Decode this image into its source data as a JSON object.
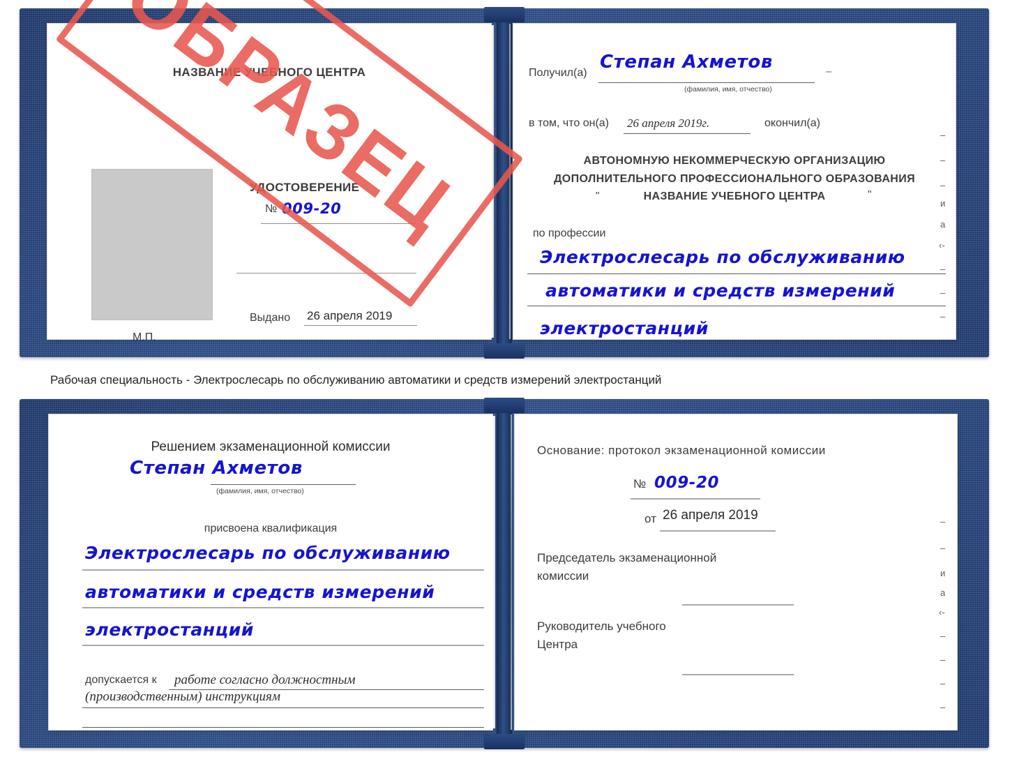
{
  "stamp": {
    "text": "ОБРАЗЕЦ",
    "color": "#e8584f"
  },
  "colors": {
    "cover_blue": "#24427a",
    "page_white": "#ffffff",
    "handwriting_blue": "#1414d2",
    "photo_placeholder_gray": "#c9c9c9",
    "rule_gray": "#8f8f8f"
  },
  "caption": {
    "text": "Рабочая специальность - Электрослесарь по обслуживанию автоматики и средств измерений электростанций"
  },
  "certificate_top": {
    "left_page": {
      "center_name": "НАЗВАНИЕ УЧЕБНОГО ЦЕНТРА",
      "doc_title": "УДОСТОВЕРЕНИЕ",
      "number_label": "№",
      "number_value": "009-20",
      "issued_label": "Выдано",
      "issued_value": "26 апреля 2019",
      "seal_mark": "М.П.",
      "photo_placeholder": "photo-placeholder"
    },
    "right_page": {
      "received_label": "Получил(а)",
      "received_value": "Степан Ахметов",
      "fio_hint": "(фамилия, имя, отчество)",
      "that_he_label": "в том, что он(а)",
      "that_he_value": "26 апреля 2019г.",
      "finished_label": "окончил(а)",
      "org_line1": "АВТОНОМНУЮ НЕКОММЕРЧЕСКУЮ ОРГАНИЗАЦИЮ",
      "org_line2": "ДОПОЛНИТЕЛЬНОГО ПРОФЕССИОНАЛЬНОГО ОБРАЗОВАНИЯ",
      "org_quote_open": "\"",
      "org_line3": "НАЗВАНИЕ УЧЕБНОГО ЦЕНТРА",
      "org_quote_close": "\"",
      "profession_label": "по профессии",
      "profession_line1": "Электрослесарь по обслуживанию",
      "profession_line2": "автоматики и средств измерений",
      "profession_line3": "электростанций",
      "edge_fragments": [
        "–",
        "–",
        "–",
        "и",
        "а",
        "‹-",
        "–",
        "–",
        "–"
      ]
    }
  },
  "certificate_bottom": {
    "left_page": {
      "decision_header": "Решением экзаменационной комиссии",
      "name_value": "Степан Ахметов",
      "fio_hint": "(фамилия, имя, отчество)",
      "qualification_label": "присвоена квалификация",
      "qualification_line1": "Электрослесарь по обслуживанию",
      "qualification_line2": "автоматики и средств измерений",
      "qualification_line3": "электростанций",
      "admitted_label": "допускается к",
      "admitted_line1": "работе согласно должностным",
      "admitted_line2": "(производственным) инструкциям"
    },
    "right_page": {
      "basis_label": "Основание: протокол экзаменационной комиссии",
      "protocol_number_label": "№",
      "protocol_number_value": "009-20",
      "protocol_date_label": "от",
      "protocol_date_value": "26 апреля 2019",
      "chairman_line1": "Председатель экзаменационной",
      "chairman_line2": "комиссии",
      "head_line1": "Руководитель учебного",
      "head_line2": "Центра",
      "edge_fragments": [
        "–",
        "–",
        "и",
        "а",
        "‹-",
        "–",
        "–",
        "–",
        "–"
      ]
    }
  }
}
